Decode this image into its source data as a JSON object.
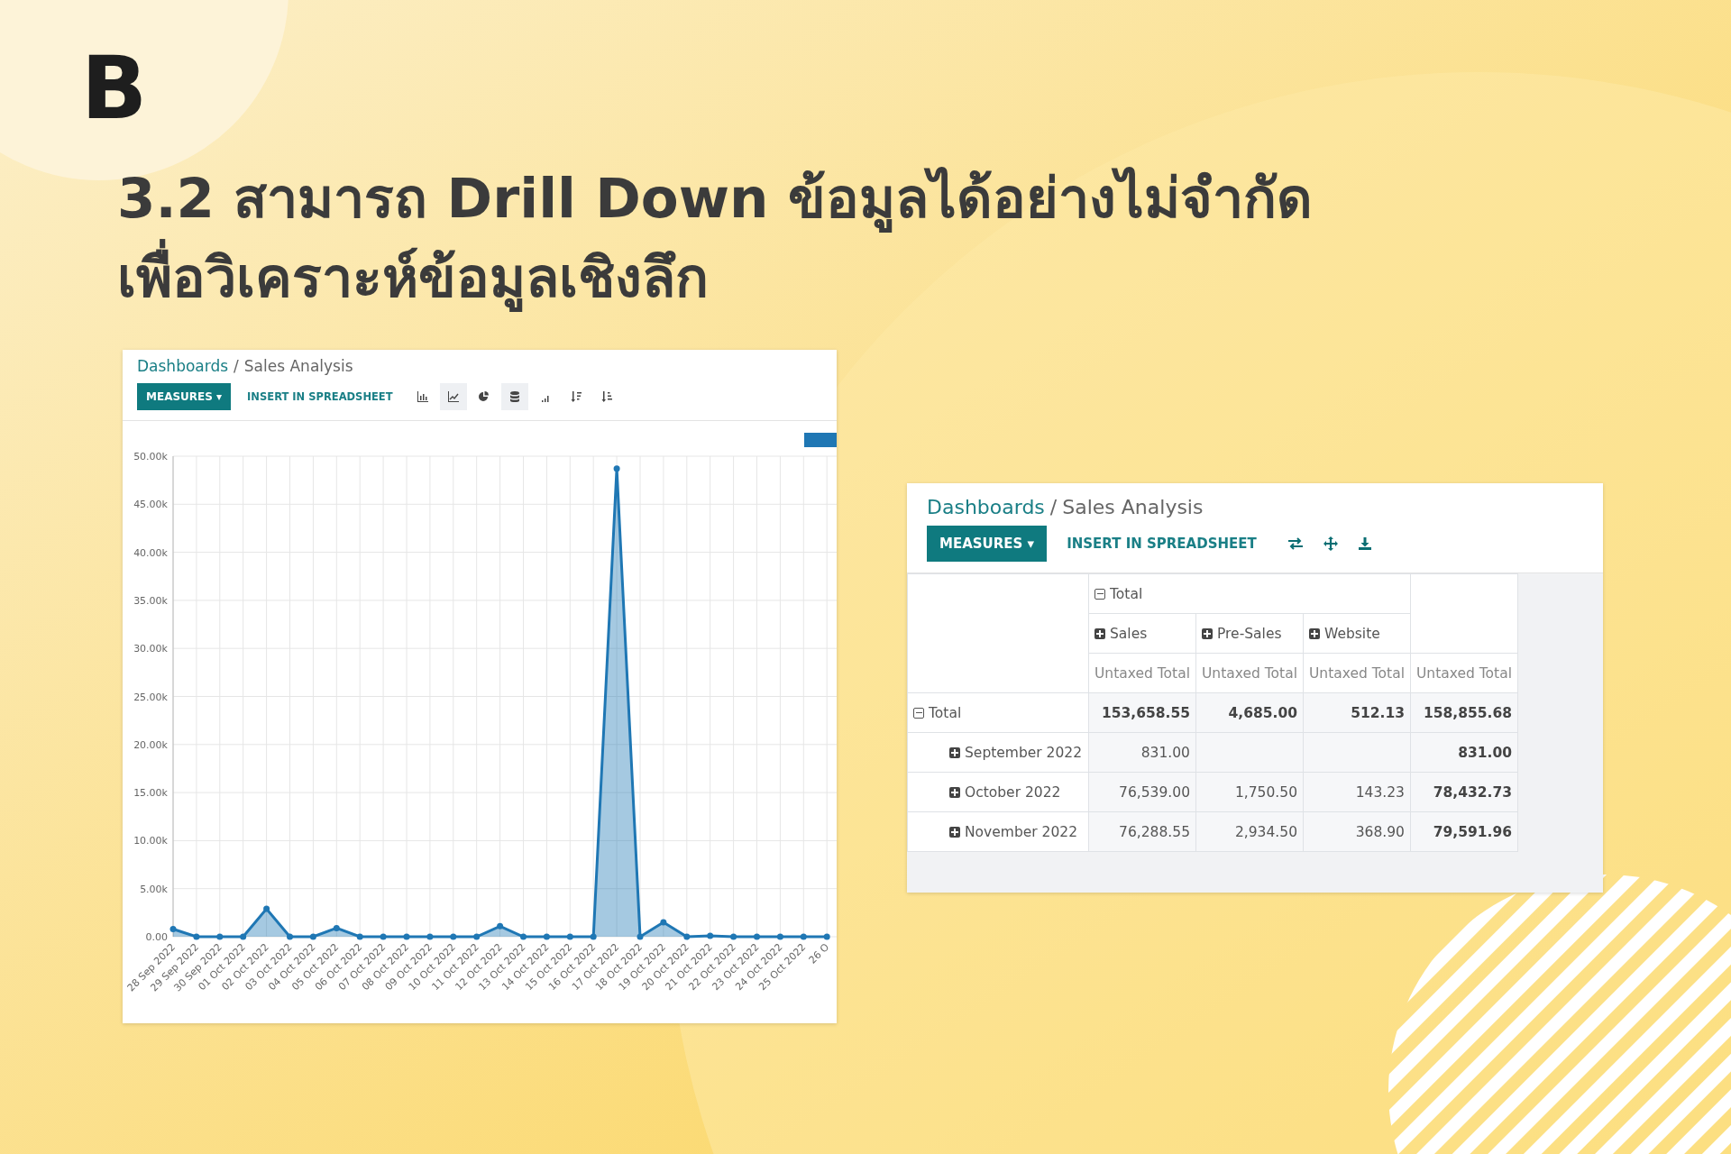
{
  "logo": "B",
  "title": [
    "3.2 สามารถ Drill Down ข้อมูลได้อย่างไม่จำกัด",
    "เพื่อวิเคราะห์ข้อมูลเชิงลึก"
  ],
  "graph_view": {
    "breadcrumb": {
      "parent": "Dashboards",
      "separator": "/",
      "current": "Sales Analysis"
    },
    "measures_button": "MEASURES",
    "measures_caret": "▾",
    "insert_button": "INSERT IN SPREADSHEET",
    "tools": [
      {
        "kind": "bar",
        "selected": false
      },
      {
        "kind": "line",
        "selected": true
      },
      {
        "kind": "pie",
        "selected": false
      },
      {
        "kind": "stacked",
        "selected": true
      },
      {
        "kind": "cumulative",
        "selected": false
      },
      {
        "kind": "sort_desc",
        "selected": false
      },
      {
        "kind": "sort_asc",
        "selected": false
      }
    ],
    "chart_data": {
      "type": "area",
      "categories": [
        "28 Sep 2022",
        "29 Sep 2022",
        "30 Sep 2022",
        "01 Oct 2022",
        "02 Oct 2022",
        "03 Oct 2022",
        "04 Oct 2022",
        "05 Oct 2022",
        "06 Oct 2022",
        "07 Oct 2022",
        "08 Oct 2022",
        "09 Oct 2022",
        "10 Oct 2022",
        "11 Oct 2022",
        "12 Oct 2022",
        "13 Oct 2022",
        "14 Oct 2022",
        "15 Oct 2022",
        "16 Oct 2022",
        "17 Oct 2022",
        "18 Oct 2022",
        "19 Oct 2022",
        "20 Oct 2022",
        "21 Oct 2022",
        "22 Oct 2022",
        "23 Oct 2022",
        "24 Oct 2022",
        "25 Oct 2022",
        "26 O"
      ],
      "series": [
        {
          "color": "#1f77b4",
          "values": [
            800,
            0,
            0,
            0,
            2900,
            0,
            0,
            900,
            0,
            0,
            0,
            0,
            0,
            0,
            1100,
            0,
            0,
            0,
            0,
            48700,
            0,
            1500,
            0,
            100,
            0,
            0,
            0,
            0,
            0
          ]
        }
      ],
      "ylim": [
        0,
        50000
      ],
      "grid": true,
      "yticks": [
        {
          "value": 0,
          "label": "0.00"
        },
        {
          "value": 5000,
          "label": "5.00k"
        },
        {
          "value": 10000,
          "label": "10.00k"
        },
        {
          "value": 15000,
          "label": "15.00k"
        },
        {
          "value": 20000,
          "label": "20.00k"
        },
        {
          "value": 25000,
          "label": "25.00k"
        },
        {
          "value": 30000,
          "label": "30.00k"
        },
        {
          "value": 35000,
          "label": "35.00k"
        },
        {
          "value": 40000,
          "label": "40.00k"
        },
        {
          "value": 45000,
          "label": "45.00k"
        },
        {
          "value": 50000,
          "label": "50.00k"
        }
      ]
    }
  },
  "pivot_view": {
    "breadcrumb": {
      "parent": "Dashboards",
      "separator": "/",
      "current": "Sales Analysis"
    },
    "measures_button": "MEASURES",
    "measures_caret": "▾",
    "insert_button": "INSERT IN SPREADSHEET",
    "tools": [
      {
        "kind": "flip"
      },
      {
        "kind": "expand"
      },
      {
        "kind": "download"
      }
    ],
    "column_header": {
      "label": "Total",
      "expanded": true
    },
    "groups": [
      {
        "label": "Sales",
        "expanded": false
      },
      {
        "label": "Pre-Sales",
        "expanded": false
      },
      {
        "label": "Website",
        "expanded": false
      }
    ],
    "measures": [
      "Untaxed Total",
      "Untaxed Total",
      "Untaxed Total",
      "Untaxed Total"
    ],
    "rows": [
      {
        "label": "Total",
        "expanded": true,
        "cells": [
          "153,658.55",
          "4,685.00",
          "512.13",
          "158,855.68"
        ],
        "children": [
          {
            "label": "September 2022",
            "expanded": false,
            "cells": [
              "831.00",
              null,
              null,
              "831.00"
            ]
          },
          {
            "label": "October 2022",
            "expanded": false,
            "cells": [
              "76,539.00",
              "1,750.50",
              "143.23",
              "78,432.73"
            ]
          },
          {
            "label": "November 2022",
            "expanded": false,
            "cells": [
              "76,288.55",
              "2,934.50",
              "368.90",
              "79,591.96"
            ]
          }
        ]
      }
    ]
  }
}
